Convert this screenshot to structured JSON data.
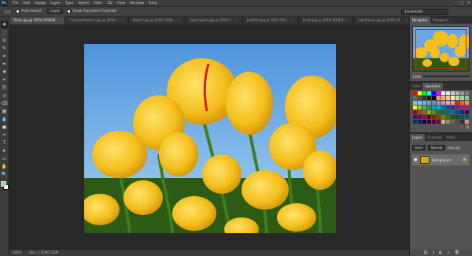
{
  "menubar": {
    "logo": "Ps",
    "items": [
      "File",
      "Edit",
      "Image",
      "Layer",
      "Type",
      "Select",
      "Filter",
      "3D",
      "View",
      "Window",
      "Help"
    ],
    "window_controls": [
      "–",
      "□",
      "✕"
    ]
  },
  "options": {
    "auto_select_label": "Auto-Select:",
    "auto_select_value": "Layer",
    "show_transform_label": "Show Transform Controls"
  },
  "workspace": "Essentials",
  "tools": [
    "move-tool",
    "marquee-tool",
    "lasso-tool",
    "quick-select-tool",
    "crop-tool",
    "eyedropper-tool",
    "healing-tool",
    "brush-tool",
    "stamp-tool",
    "history-brush-tool",
    "eraser-tool",
    "gradient-tool",
    "blur-tool",
    "dodge-tool",
    "pen-tool",
    "type-tool",
    "path-select-tool",
    "shape-tool",
    "hand-tool",
    "zoom-tool"
  ],
  "tool_glyphs": [
    "✥",
    "⬚",
    "ʘ",
    "✎",
    "⌗",
    "✒",
    "✚",
    "✍",
    "⎘",
    "↺",
    "⌫",
    "▦",
    "💧",
    "●",
    "✑",
    "T",
    "➤",
    "▭",
    "✋",
    "🔍"
  ],
  "colors": {
    "foreground": "#9bd3a3",
    "background": "#ffffff",
    "accent": "#d62020"
  },
  "doc_tabs": [
    {
      "label": "Tulips.jpg @ 100% (RGB/8)",
      "active": true
    },
    {
      "label": "Chrysanthemum.jpg @ 100% ...",
      "active": false
    },
    {
      "label": "Desert.jpg @ 100% (RGB...",
      "active": false
    },
    {
      "label": "Hydrangeas.jpg @ 100% (...",
      "active": false
    },
    {
      "label": "Jellyfish.jpg @ 100% (RG...",
      "active": false
    },
    {
      "label": "Koala.jpg @ 100% (RGB/8)",
      "active": false
    },
    {
      "label": "Lighthouse.jpg @ 100% (R...",
      "active": false
    },
    {
      "label": "Penguins.jpg @ 100% (RG...",
      "active": false
    }
  ],
  "status": {
    "zoom": "100%",
    "doc_size": "Doc: 2.25M/2.25M"
  },
  "navigator": {
    "tabs": [
      "Navigator",
      "Histogram"
    ],
    "zoom": "100%"
  },
  "swatches_panel": {
    "tabs": [
      "Color",
      "Swatches"
    ]
  },
  "swatches": [
    "#ff0000",
    "#ffff00",
    "#00ff00",
    "#00ffff",
    "#0000ff",
    "#ff00ff",
    "#ffffff",
    "#e6e6e6",
    "#cccccc",
    "#b3b3b3",
    "#999999",
    "#808080",
    "#666666",
    "#4d4d4d",
    "#333333",
    "#1a1a1a",
    "#000000",
    "#f7977a",
    "#f9ad81",
    "#fdc68a",
    "#fff79a",
    "#c4df9b",
    "#a2d39c",
    "#82ca9d",
    "#7bcdc8",
    "#6ecff6",
    "#7ea7d8",
    "#8493ca",
    "#8882be",
    "#a187be",
    "#bc8dbf",
    "#f49ac2",
    "#f6989d",
    "#ed1c24",
    "#f26522",
    "#f7941d",
    "#fff200",
    "#8dc63f",
    "#39b54a",
    "#00a651",
    "#00a99d",
    "#00aeef",
    "#0072bc",
    "#0054a6",
    "#2e3192",
    "#662d91",
    "#92278f",
    "#ec008c",
    "#9e0b0f",
    "#a0410d",
    "#a36209",
    "#aba000",
    "#598527",
    "#1a7b30",
    "#007236",
    "#00746b",
    "#0076a3",
    "#004b80",
    "#003471",
    "#1b1464",
    "#440e62",
    "#630460",
    "#9e005d",
    "#790000",
    "#7b2e00",
    "#7d4900",
    "#827b00",
    "#406618",
    "#005e20",
    "#005826",
    "#005952",
    "#005b7f",
    "#003663",
    "#002157",
    "#0d004c",
    "#32004b",
    "#4b0049",
    "#7b0046",
    "#c7b299",
    "#998675",
    "#736357",
    "#534741",
    "#37302d",
    "#c69c6d"
  ],
  "layers": {
    "tabs": [
      "Layers",
      "Channels",
      "Paths"
    ],
    "filter_label": "Kind",
    "blend_mode": "Normal",
    "opacity_label": "Opacity:",
    "items": [
      {
        "name": "Background",
        "visible": true,
        "locked": true
      }
    ]
  }
}
